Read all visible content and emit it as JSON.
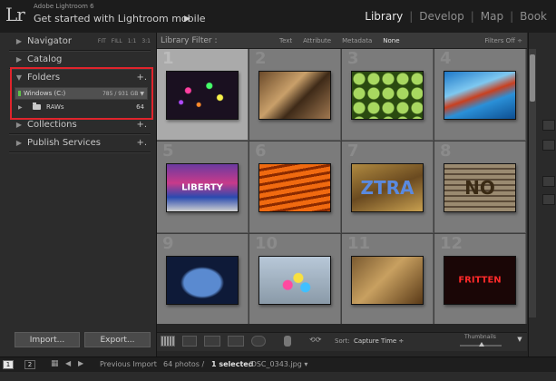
{
  "window": {
    "logo": "Lr",
    "app_version": "Adobe Lightroom 6",
    "subtitle": "Get started with Lightroom mobile",
    "subtitle_arrow": "▶"
  },
  "modules": [
    {
      "label": "Library",
      "active": true
    },
    {
      "label": "Develop",
      "active": false
    },
    {
      "label": "Map",
      "active": false
    },
    {
      "label": "Book",
      "active": false
    }
  ],
  "left_panel": {
    "navigator": {
      "label": "Navigator",
      "options": [
        "FIT",
        "FILL",
        "1:1",
        "3:1"
      ]
    },
    "catalog": {
      "label": "Catalog"
    },
    "folders": {
      "label": "Folders",
      "plus": "+.",
      "volume": {
        "name": "Windows (C:)",
        "size": "785 / 931 GB"
      },
      "folder": {
        "name": "RAWs",
        "count": "64"
      }
    },
    "collections": {
      "label": "Collections",
      "plus": "+."
    },
    "publish": {
      "label": "Publish Services",
      "plus": "+."
    },
    "import_label": "Import...",
    "export_label": "Export..."
  },
  "filter_bar": {
    "title": "Library Filter :",
    "options": [
      {
        "label": "Text",
        "active": false
      },
      {
        "label": "Attribute",
        "active": false
      },
      {
        "label": "Metadata",
        "active": false
      },
      {
        "label": "None",
        "active": true
      }
    ],
    "status": "Filters Off ÷"
  },
  "grid": {
    "cells": [
      {
        "num": "1",
        "selected": true,
        "thumb": {
          "bg": "radial-gradient(circle at 30% 40%, #ff3fa0 0 3px, transparent 4px), radial-gradient(circle at 60% 30%, #45ff6a 0 3px, transparent 4px), radial-gradient(circle at 75% 55%, #f7f24a 0 3px, transparent 4px), radial-gradient(circle at 45% 70%, #ff8a2a 0 2px, transparent 3px), radial-gradient(circle at 20% 65%, #b04aff 0 2px, transparent 3px), #1a1020",
          "text": "",
          "color": "#fff"
        }
      },
      {
        "num": "2",
        "selected": false,
        "thumb": {
          "bg": "linear-gradient(135deg, #6b4a2a, #c9a06a 40%, #3e2a18 60%, #a07850)",
          "text": "",
          "color": "#fff"
        }
      },
      {
        "num": "3",
        "selected": false,
        "thumb": {
          "bg": "radial-gradient(circle, #a8d860 0 6px, #2a4a10 7px) 0 0/16px 16px, #1a3008",
          "text": "",
          "color": "#fff"
        }
      },
      {
        "num": "4",
        "selected": false,
        "thumb": {
          "bg": "linear-gradient(160deg, #1e78c8, #7ec8f0 35%, #c84020 50%, #2a90d8 65%, #0e4e90)",
          "text": "",
          "color": "#fff"
        }
      },
      {
        "num": "5",
        "selected": false,
        "thumb": {
          "bg": "linear-gradient(180deg, #6a3aa0, #c83a8a 40%, #2a4ab0 70%, #d0d0d0)",
          "text": "LIBERTY",
          "color": "#ffffff"
        }
      },
      {
        "num": "6",
        "selected": false,
        "thumb": {
          "bg": "repeating-linear-gradient(170deg, #f06a10 0 5px, #8a2a00 5px 8px)",
          "text": "",
          "color": "#fff"
        }
      },
      {
        "num": "7",
        "selected": false,
        "thumb": {
          "bg": "linear-gradient(160deg, #b08a40, #6a4a20 50%, #c8a050)",
          "text": "ZTRA",
          "color": "#5a8ae0"
        }
      },
      {
        "num": "8",
        "selected": false,
        "thumb": {
          "bg": "repeating-linear-gradient(180deg, #9a8a70 0 4px, #5a4a38 4px 6px)",
          "text": "NO",
          "color": "#3a2a14"
        }
      },
      {
        "num": "9",
        "selected": false,
        "thumb": {
          "bg": "radial-gradient(ellipse at 50% 55%, #5a8ad0 0 20px, #0e1a38 24px)",
          "text": "",
          "color": "#fff"
        }
      },
      {
        "num": "10",
        "selected": false,
        "thumb": {
          "bg": "radial-gradient(circle at 40% 60%, #ff4aa0 0 5px, transparent 6px), radial-gradient(circle at 55% 45%, #f8e040 0 5px, transparent 6px), radial-gradient(circle at 65% 65%, #40c0ff 0 5px, transparent 6px), linear-gradient(#b8c8d8, #8a9aa8)",
          "text": "",
          "color": "#fff"
        }
      },
      {
        "num": "11",
        "selected": false,
        "thumb": {
          "bg": "linear-gradient(135deg, #7a5a30, #c8a060 45%, #5a3a18)",
          "text": "",
          "color": "#fff"
        }
      },
      {
        "num": "12",
        "selected": false,
        "thumb": {
          "bg": "#1a0606",
          "text": "FRITTEN",
          "color": "#ff2a2a"
        }
      }
    ]
  },
  "toolbar": {
    "sort_label": "Sort:",
    "sort_value": "Capture Time ÷",
    "thumbnails_label": "Thumbnails",
    "menu_icon": "▼"
  },
  "filmstrip": {
    "screen1": "1",
    "screen2": "2",
    "source": "Previous Import",
    "summary_prefix": "64 photos /",
    "selected_text": "1 selected",
    "filename": "/DSC_0343.jpg ▾"
  },
  "colors": {
    "highlight": "#e0242c",
    "module_active": "#e6e6e6"
  }
}
